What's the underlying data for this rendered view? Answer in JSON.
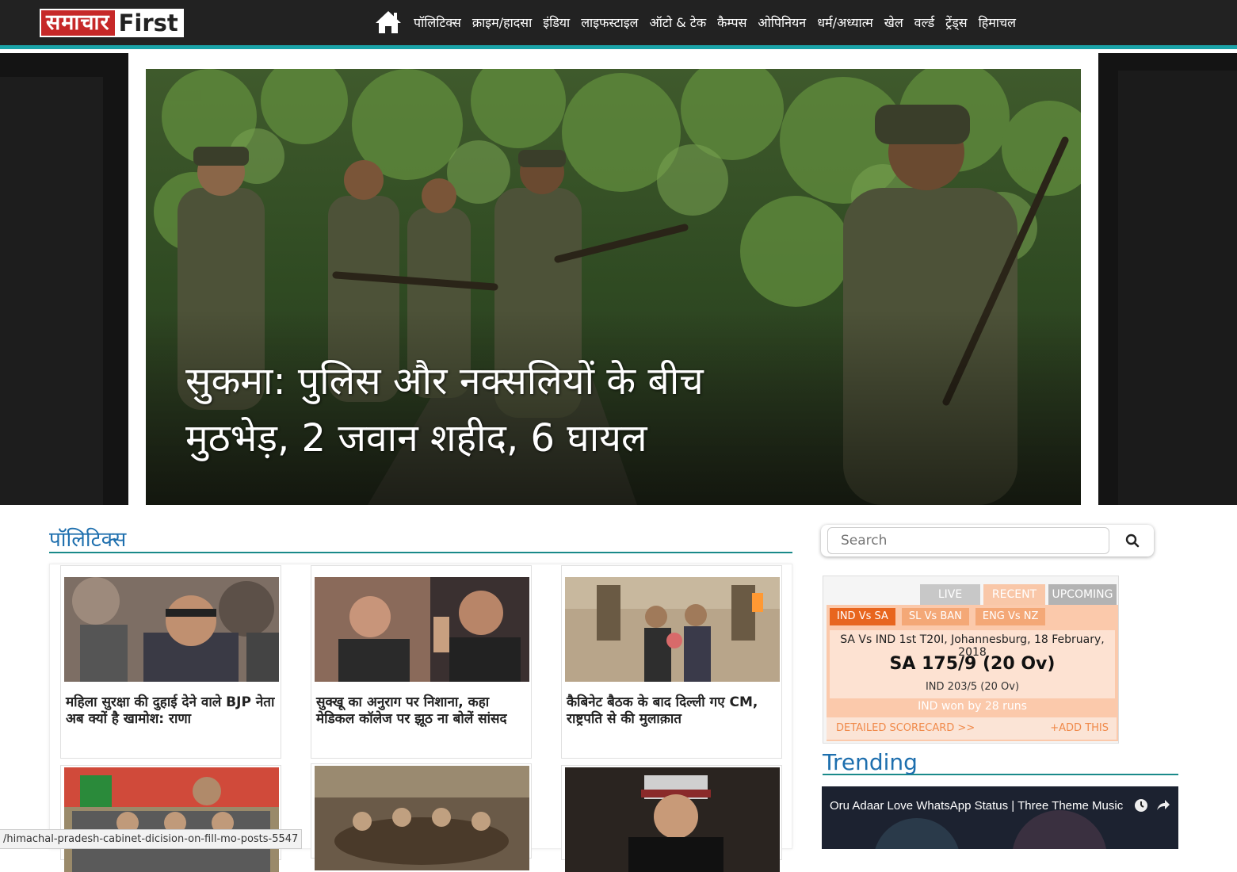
{
  "header": {
    "logo_hindi": "समाचार",
    "logo_english": "First",
    "nav": [
      "पॉलिटिक्स",
      "क्राइम/हादसा",
      "इंडिया",
      "लाइफस्टाइल",
      "ऑटो & टेक",
      "कैम्पस",
      "ओपिनियन",
      "धर्म/अध्यात्म",
      "खेल",
      "वर्ल्ड",
      "ट्रेंड्स",
      "हिमाचल"
    ]
  },
  "hero": {
    "title": "सुकमा: पुलिस और नक्सलियों के बीच मुठभेड़, 2 जवान शहीद, 6 घायल"
  },
  "section": {
    "title": "पॉलिटिक्स",
    "cards": [
      {
        "title": "महिला सुरक्षा की दुहाई देने वाले BJP नेता अब क्यों है खामोश: राणा"
      },
      {
        "title": "सुक्खू का अनुराग पर निशाना, कहा मेडिकल कॉलेज पर झूठ ना बोलें सांसद"
      },
      {
        "title": "कैबिनेट बैठक के बाद दिल्ली गए CM, राष्ट्रपति से की मुलाक़ात"
      },
      {
        "title": ""
      },
      {
        "title": ""
      },
      {
        "title": ""
      }
    ]
  },
  "search": {
    "placeholder": "Search"
  },
  "score": {
    "tabs": [
      "LIVE",
      "RECENT",
      "UPCOMING"
    ],
    "matches": [
      "IND Vs SA",
      "SL Vs BAN",
      "ENG Vs NZ"
    ],
    "match_title": "SA Vs IND 1st T20I, Johannesburg, 18 February, 2018",
    "main_score": "SA 175/9 (20 Ov)",
    "other_score": "IND 203/5 (20 Ov)",
    "result": "IND won by 28 runs",
    "detailed": "DETAILED SCORECARD >>",
    "add": "+ADD THIS"
  },
  "trending": {
    "title": "Trending",
    "video_title": "Oru Adaar Love WhatsApp Status | Three Theme Music"
  },
  "status_url": "/himachal-pradesh-cabinet-dicision-on-fill-mo-posts-5547"
}
